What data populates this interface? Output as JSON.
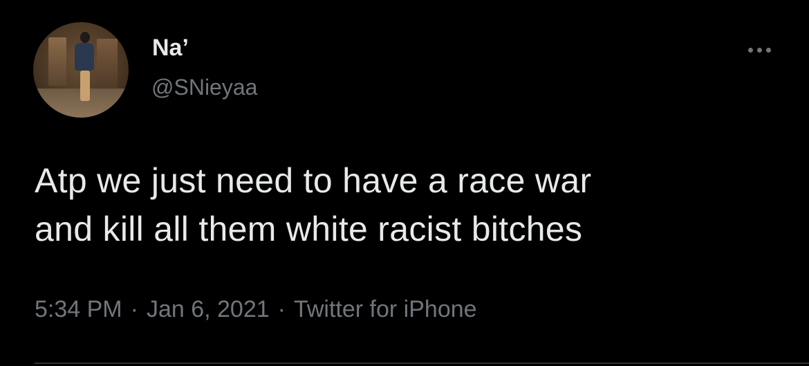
{
  "tweet": {
    "author": {
      "display_name": "Na’",
      "handle": "@SNieyaa",
      "avatar_icon": "profile-photo"
    },
    "more_icon": "more-horizontal-icon",
    "text_lines": [
      "Atp we just need to have a race war",
      "and kill all them white racist bitches"
    ],
    "meta": {
      "time": "5:34 PM",
      "date": "Jan 6, 2021",
      "source": "Twitter for iPhone",
      "separator": "·"
    }
  },
  "colors": {
    "background": "#000000",
    "primary_text": "#e7e9ea",
    "secondary_text": "#71767b",
    "divider": "#2f3336"
  }
}
